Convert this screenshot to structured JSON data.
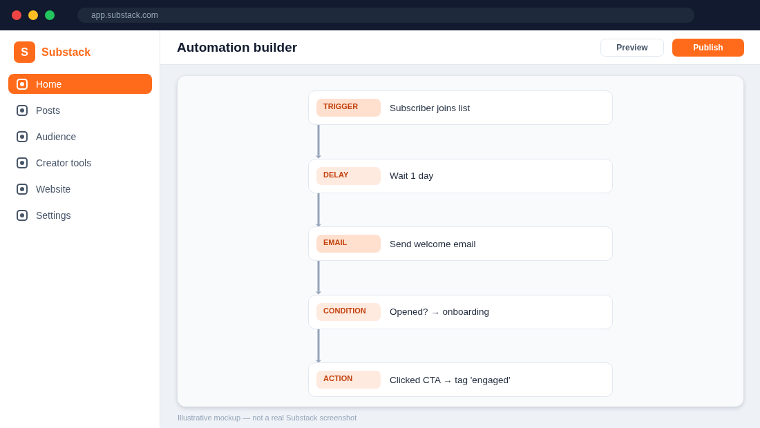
{
  "browser": {
    "url": "app.substack.com"
  },
  "sidebar": {
    "logo_letter": "S",
    "brand": "Substack",
    "items": [
      {
        "label": "Home",
        "selected": true
      },
      {
        "label": "Posts",
        "selected": false
      },
      {
        "label": "Audience",
        "selected": false
      },
      {
        "label": "Creator tools",
        "selected": false
      },
      {
        "label": "Website",
        "selected": false
      },
      {
        "label": "Settings",
        "selected": false
      }
    ]
  },
  "header": {
    "title": "Automation builder",
    "buttons": [
      {
        "label": "Preview",
        "kind": "secondary"
      },
      {
        "label": "Publish",
        "kind": "primary"
      }
    ]
  },
  "flow": {
    "steps": [
      {
        "type": "TRIGGER",
        "text": "Subscriber joins list",
        "color": "#ffe0cf"
      },
      {
        "type": "DELAY",
        "text": "Wait 1 day",
        "color": "#ffeadf"
      },
      {
        "type": "EMAIL",
        "text": "Send welcome email",
        "color": "#ffe0cf"
      },
      {
        "type": "CONDITION",
        "text": "Opened? → onboarding",
        "color": "#ffeadf"
      },
      {
        "type": "ACTION",
        "text": "Clicked CTA → tag 'engaged'",
        "color": "#ffeadf"
      }
    ]
  },
  "footer_note": "Illustrative mockup — not a real Substack screenshot"
}
